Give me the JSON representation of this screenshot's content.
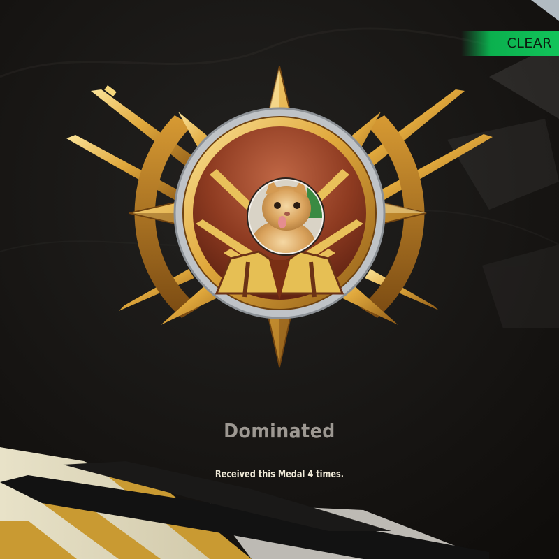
{
  "header": {
    "clear_label": "CLEAR"
  },
  "medal": {
    "name": "Dominated",
    "received_text": "Received this Medal 4 times.",
    "emblem_icon": "rifles-star-medal-icon",
    "avatar_icon": "cat-avatar-icon"
  },
  "colors": {
    "gold": "#e7b74b",
    "clear_green": "#12c45a",
    "medal_red": "#8b3a22"
  }
}
